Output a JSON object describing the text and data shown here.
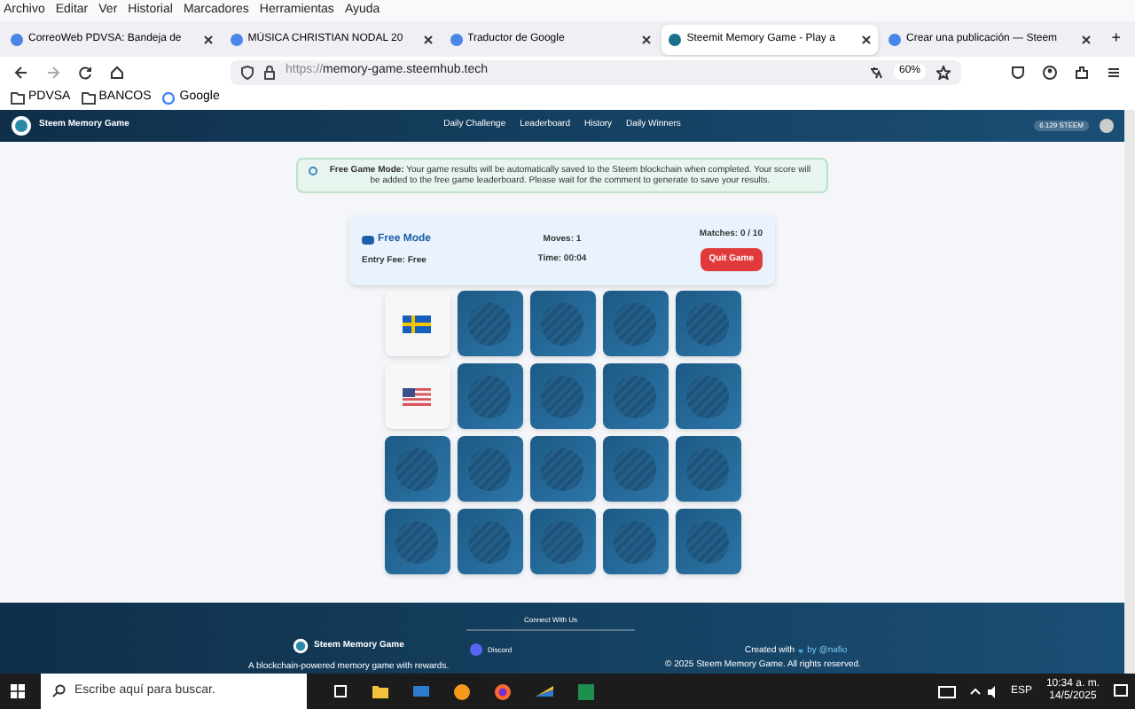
{
  "menu": [
    "Archivo",
    "Editar",
    "Ver",
    "Historial",
    "Marcadores",
    "Herramientas",
    "Ayuda"
  ],
  "tabs": [
    {
      "label": "CorreoWeb PDVSA: Bandeja de",
      "selected": false
    },
    {
      "label": "MÚSICA CHRISTIAN NODAL 20",
      "selected": false
    },
    {
      "label": "Traductor de Google",
      "selected": false
    },
    {
      "label": "Steemit Memory Game - Play a",
      "selected": true
    },
    {
      "label": "Crear una publicación — Steem",
      "selected": false
    }
  ],
  "new_tab": "+",
  "address": {
    "prefix": "https://",
    "host": "memory-game.steemhub.tech",
    "zoom": "60%"
  },
  "bookmarks": [
    "PDVSA",
    "BANCOS",
    "Google"
  ],
  "site": {
    "brand": "Steem Memory Game",
    "nav": [
      "Daily Challenge",
      "Leaderboard",
      "History",
      "Daily Winners"
    ],
    "balance": "6.129 STEEM"
  },
  "notice": {
    "text": "**Free Game Mode:** Your game results will be automatically saved to the Steem blockchain when completed. Your score will be added to the free game leaderboard. Please wait for the comment to generate to save your results."
  },
  "game": {
    "mode": "Free Mode",
    "fee": "Entry Fee: Free",
    "moves": "Moves: 1",
    "time": "Time: 00:04",
    "matches": "Matches: 0 / 10",
    "quit": "Quit Game"
  },
  "cards": [
    {
      "kind": "face-up"
    },
    {
      "kind": "face-down"
    },
    {
      "kind": "face-down"
    },
    {
      "kind": "face-down"
    },
    {
      "kind": "face-down"
    },
    {
      "kind": "face-up"
    },
    {
      "kind": "face-down"
    },
    {
      "kind": "face-down"
    },
    {
      "kind": "face-down"
    },
    {
      "kind": "face-down"
    },
    {
      "kind": "face-down"
    },
    {
      "kind": "face-down"
    },
    {
      "kind": "face-down"
    },
    {
      "kind": "face-down"
    },
    {
      "kind": "face-down"
    },
    {
      "kind": "face-down"
    },
    {
      "kind": "face-down"
    },
    {
      "kind": "face-down"
    },
    {
      "kind": "face-down"
    },
    {
      "kind": "face-down"
    }
  ],
  "footer": {
    "connect": "Connect With Us",
    "brand": "Steem Memory Game",
    "tagline": "A blockchain-powered memory game with rewards.",
    "discord": "Discord",
    "created": "Created with",
    "by": "by @nafio",
    "copyright": "© 2025 Steem Memory Game. All rights reserved."
  },
  "taskbar": {
    "search": "Escribe aquí para buscar.",
    "lang": "ESP",
    "time": "10:34 a. m.",
    "date": "14/5/2025"
  }
}
